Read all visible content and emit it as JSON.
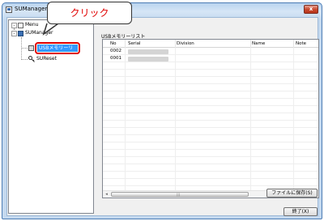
{
  "window": {
    "title": "SUManager",
    "close_glyph": "x"
  },
  "callout": {
    "text": "クリック"
  },
  "tree": {
    "root_label": "Menu",
    "root_expander": "-",
    "child_expander": "-",
    "items": [
      {
        "label": "SUManager"
      },
      {
        "label": "USBメモリーリスト",
        "selected": true
      },
      {
        "label": "SUReset"
      }
    ]
  },
  "list": {
    "caption": "USBメモリーリスト",
    "columns": [
      "No",
      "Serial",
      "Division",
      "Name",
      "Note"
    ],
    "rows": [
      {
        "no": "0002",
        "serial": ""
      },
      {
        "no": "0001",
        "serial": ""
      }
    ],
    "scroll_left": "◂",
    "scroll_right": "▸",
    "scroll_grip": "|||"
  },
  "buttons": {
    "save": "ファイルに保存(S)",
    "exit": "終了(X)"
  },
  "colors": {
    "accent": "#3399ff",
    "callout_text": "#e00000",
    "ring": "#e00000"
  }
}
